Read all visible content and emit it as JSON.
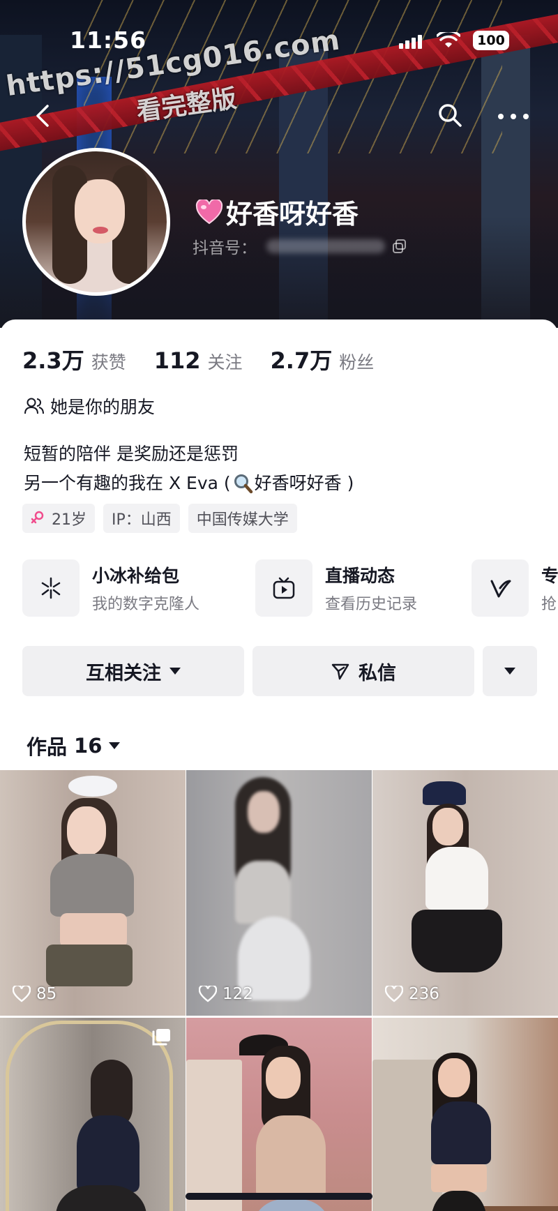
{
  "status_bar": {
    "time": "11:56",
    "battery": "100"
  },
  "watermark": {
    "line1": "https://51cg016.com",
    "line2": "看完整版"
  },
  "profile": {
    "name": "好香呀好香",
    "id_label": "抖音号："
  },
  "stats": [
    {
      "value": "2.3万",
      "label": "获赞"
    },
    {
      "value": "112",
      "label": "关注"
    },
    {
      "value": "2.7万",
      "label": "粉丝"
    }
  ],
  "relation": "她是你的朋友",
  "bio": {
    "line1": "短暂的陪伴 是奖励还是惩罚",
    "line2_prefix": "另一个有趣的我在 X Eva (",
    "line2_suffix": "好香呀好香 )"
  },
  "tags": {
    "age": "21岁",
    "ip": "IP：山西",
    "school": "中国传媒大学"
  },
  "services": [
    {
      "icon": "sparkle-icon",
      "title": "小冰补给包",
      "subtitle": "我的数字克隆人"
    },
    {
      "icon": "tv-play-icon",
      "title": "直播动态",
      "subtitle": "查看历史记录"
    },
    {
      "icon": "v-logo-icon",
      "title": "专",
      "subtitle": "抢"
    }
  ],
  "actions": {
    "follow": "互相关注",
    "message": "私信"
  },
  "works": {
    "label": "作品",
    "count": "16"
  },
  "videos": [
    {
      "likes": "85"
    },
    {
      "likes": "122"
    },
    {
      "likes": "236"
    },
    {
      "likes": "",
      "multi": true
    },
    {
      "likes": ""
    },
    {
      "likes": ""
    }
  ],
  "colors": {
    "accent_pink": "#fe2c55",
    "text_primary": "#161823",
    "text_secondary": "#7a7a82",
    "button_bg": "#f0f0f2"
  }
}
